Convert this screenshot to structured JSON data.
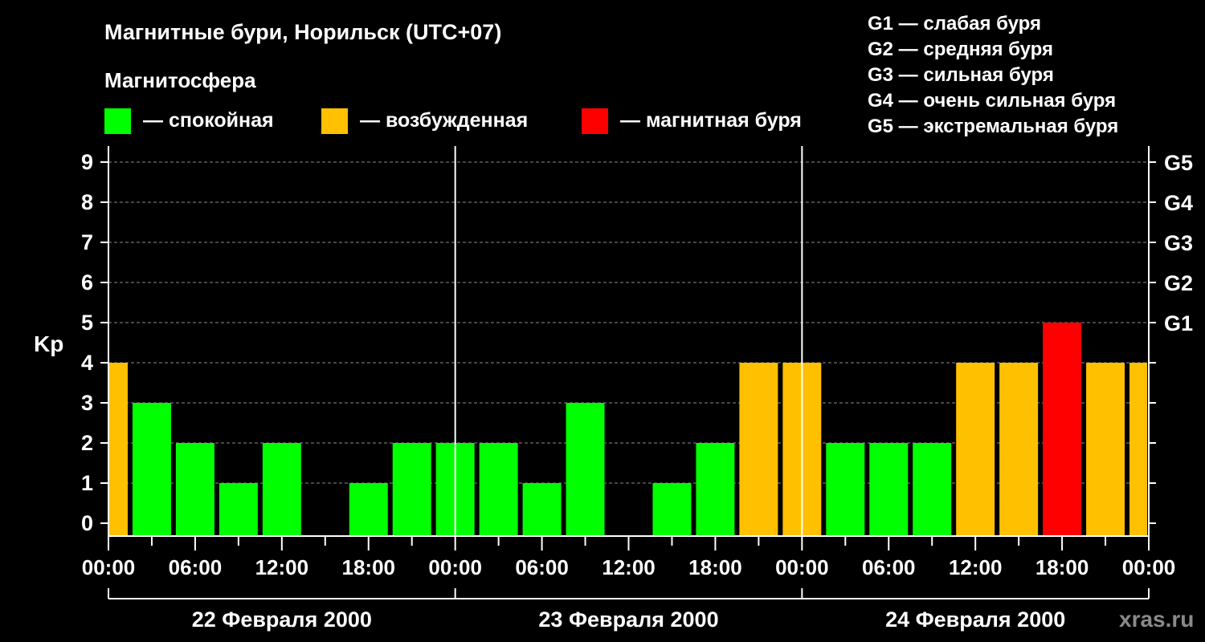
{
  "header": {
    "title": "Магнитные бури, Норильск (UTC+07)",
    "subtitle": "Магнитосфера"
  },
  "legend": [
    {
      "label": "— спокойная",
      "color": "#00ff00"
    },
    {
      "label": "— возбужденная",
      "color": "#ffc000"
    },
    {
      "label": "— магнитная буря",
      "color": "#ff0000"
    }
  ],
  "g_scale": [
    "G1 — слабая буря",
    "G2 — средняя буря",
    "G3 — сильная буря",
    "G4 — очень сильная буря",
    "G5 — экстремальная буря"
  ],
  "watermark": "xras.ru",
  "colors": {
    "quiet": "#00ff00",
    "active": "#ffc000",
    "storm": "#ff0000",
    "background": "#000000",
    "axis": "#ffffff"
  },
  "chart_data": {
    "type": "bar",
    "ylabel": "Kp",
    "ylim": [
      0,
      9
    ],
    "yticks": [
      "0",
      "1",
      "2",
      "3",
      "4",
      "5",
      "6",
      "7",
      "8",
      "9"
    ],
    "right_ticks": [
      {
        "kp": 5,
        "label": "G1"
      },
      {
        "kp": 6,
        "label": "G2"
      },
      {
        "kp": 7,
        "label": "G3"
      },
      {
        "kp": 8,
        "label": "G4"
      },
      {
        "kp": 9,
        "label": "G5"
      }
    ],
    "x_hours_range": [
      0,
      72
    ],
    "xtick_labels": [
      "00:00",
      "06:00",
      "12:00",
      "18:00",
      "00:00",
      "06:00",
      "12:00",
      "18:00",
      "00:00",
      "06:00",
      "12:00",
      "18:00",
      "00:00"
    ],
    "days": [
      "22 Февраля 2000",
      "23 Февраля 2000",
      "24 Февраля 2000"
    ],
    "grid": "dashed horizontal at each Kp level",
    "thresholds": {
      "active_from": 4,
      "storm_from": 5
    },
    "values": [
      4,
      3,
      2,
      1,
      2,
      0,
      1,
      2,
      2,
      2,
      1,
      3,
      0,
      1,
      2,
      4,
      4,
      2,
      2,
      2,
      4,
      4,
      5,
      4,
      4
    ]
  }
}
